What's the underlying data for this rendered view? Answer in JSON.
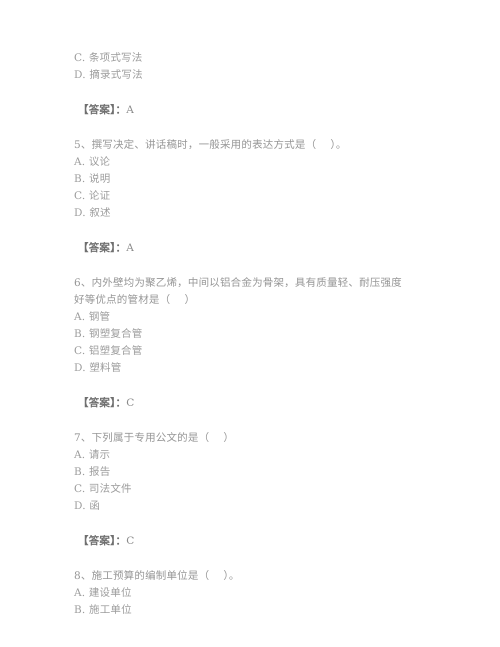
{
  "document": {
    "type": "exam-question-paper",
    "language": "zh-CN",
    "background_color": "#ffffff",
    "text_color": "#9a9a9a",
    "answer_text_color": "#6f6f6f"
  },
  "blocks": [
    {
      "id": "q4-tail",
      "kind": "options-continuation",
      "options": [
        "C. 条项式写法",
        "D. 摘录式写法"
      ],
      "answer_label": "【答案】：",
      "answer_value": "A"
    },
    {
      "id": "q5",
      "kind": "question",
      "number": "5",
      "stem_lines": [
        "5、撰写决定、讲话稿时，一般采用的表达方式是（    ）。"
      ],
      "options": [
        "A. 议论",
        "B. 说明",
        "C. 论证",
        "D. 叙述"
      ],
      "answer_label": "【答案】：",
      "answer_value": "A"
    },
    {
      "id": "q6",
      "kind": "question",
      "number": "6",
      "stem_lines": [
        "6、内外壁均为聚乙烯，中间以铝合金为骨架，具有质量轻、耐压强度",
        "好等优点的管材是（    ）"
      ],
      "options": [
        "A. 钢管",
        "B. 钢塑复合管",
        "C. 铝塑复合管",
        "D. 塑料管"
      ],
      "answer_label": "【答案】：",
      "answer_value": "C"
    },
    {
      "id": "q7",
      "kind": "question",
      "number": "7",
      "stem_lines": [
        "7、下列属于专用公文的是（    ）"
      ],
      "options": [
        "A. 请示",
        "B. 报告",
        "C. 司法文件",
        "D. 函"
      ],
      "answer_label": "【答案】：",
      "answer_value": "C"
    },
    {
      "id": "q8",
      "kind": "question",
      "number": "8",
      "stem_lines": [
        "8、施工预算的编制单位是（    ）。"
      ],
      "options": [
        "A. 建设单位",
        "B. 施工单位"
      ],
      "answer_label": null,
      "answer_value": null
    }
  ]
}
